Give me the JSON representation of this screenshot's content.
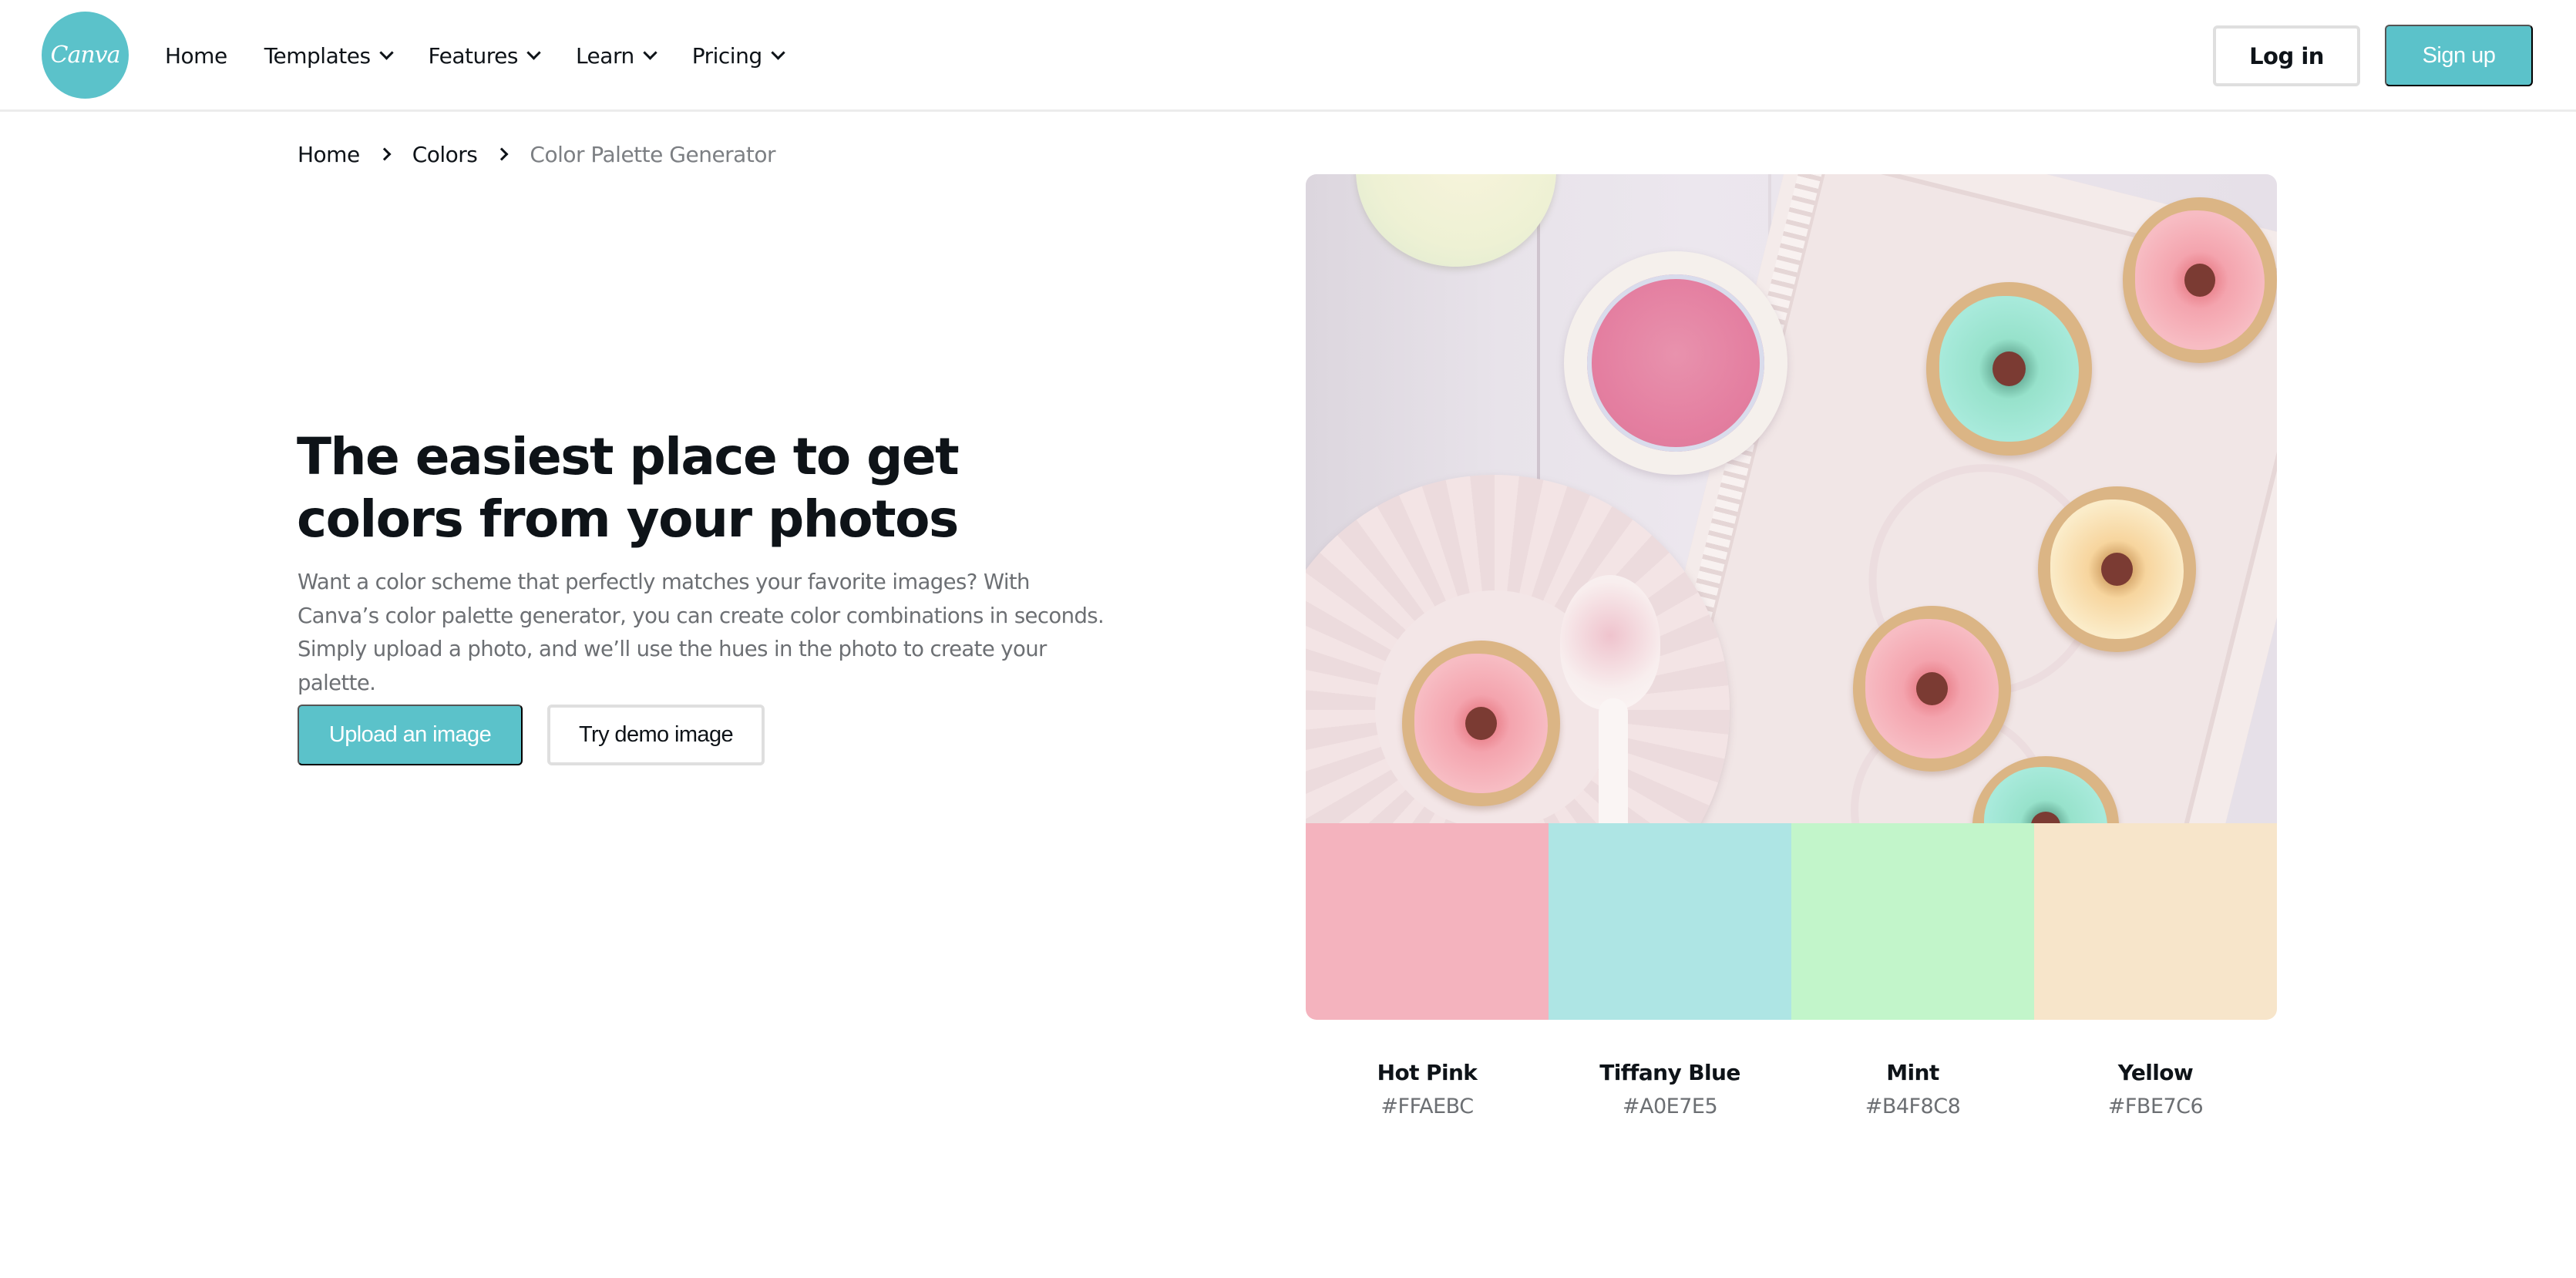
{
  "header": {
    "logo_text": "Canva",
    "nav": [
      {
        "label": "Home",
        "has_dropdown": false
      },
      {
        "label": "Templates",
        "has_dropdown": true
      },
      {
        "label": "Features",
        "has_dropdown": true
      },
      {
        "label": "Learn",
        "has_dropdown": true
      },
      {
        "label": "Pricing",
        "has_dropdown": true
      }
    ],
    "login_label": "Log in",
    "signup_label": "Sign up"
  },
  "breadcrumb": [
    {
      "label": "Home"
    },
    {
      "label": "Colors"
    },
    {
      "label": "Color Palette Generator"
    }
  ],
  "hero": {
    "title": "The easiest place to get colors from your photos",
    "description": "Want a color scheme that perfectly matches your favorite images? With Canva’s color palette generator, you can create color combinations in seconds. Simply upload a photo, and we’ll use the hues in the photo to create your palette.",
    "upload_label": "Upload an image",
    "demo_label": "Try demo image"
  },
  "photo": {
    "subject": "pastel glazed mini donuts on a white tray with pink glaze bowl"
  },
  "palette": [
    {
      "name": "Hot Pink",
      "hex": "#FFAEBC",
      "display_color": "#F4B3BE"
    },
    {
      "name": "Tiffany Blue",
      "hex": "#A0E7E5",
      "display_color": "#AEE5E4"
    },
    {
      "name": "Mint",
      "hex": "#B4F8C8",
      "display_color": "#C2F5CA"
    },
    {
      "name": "Yellow",
      "hex": "#FBE7C6",
      "display_color": "#F7E5CA"
    }
  ],
  "colors": {
    "brand": "#5BC2CA",
    "text": "#0E1318",
    "muted_text": "#6C6F73"
  }
}
